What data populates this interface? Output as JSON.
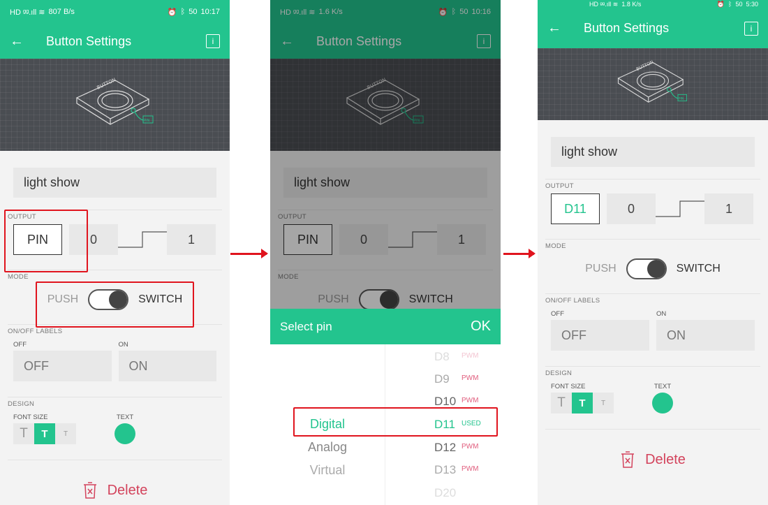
{
  "status_p1": {
    "speed": "807",
    "speed_unit": "B/s",
    "battery": "50",
    "time": "10:17"
  },
  "status_p2": {
    "speed": "1.6",
    "speed_unit": "K/s",
    "battery": "50",
    "time": "10:16"
  },
  "status_p3": {
    "speed": "1.8",
    "speed_unit": "K/s",
    "battery": "50",
    "time": "5:30"
  },
  "appbar": {
    "back": "←",
    "title": "Button Settings",
    "info": "i"
  },
  "hero": {
    "device_label": "BUTTON",
    "pin_tag": "PIN"
  },
  "form": {
    "name": "light show",
    "output_label": "OUTPUT",
    "pin": "PIN",
    "pin_selected": "D11",
    "low": "0",
    "high": "1",
    "mode_label": "MODE",
    "push": "PUSH",
    "switch": "SWITCH",
    "onoff_label": "ON/OFF LABELS",
    "off_small": "OFF",
    "on_small": "ON",
    "off_value": "OFF",
    "on_value": "ON",
    "design_label": "DESIGN",
    "font_size_label": "FONT SIZE",
    "font_sizes": [
      "T",
      "T",
      "T"
    ],
    "text_label": "TEXT",
    "delete": "Delete"
  },
  "picker": {
    "header": "Select pin",
    "ok": "OK",
    "types": [
      "Digital",
      "Analog",
      "Virtual"
    ],
    "pins": [
      {
        "name": "D8",
        "tag": "PWM"
      },
      {
        "name": "D9",
        "tag": "PWM"
      },
      {
        "name": "D10",
        "tag": "PWM"
      },
      {
        "name": "D11",
        "tag": "USED"
      },
      {
        "name": "D12",
        "tag": "PWM"
      },
      {
        "name": "D13",
        "tag": "PWM"
      },
      {
        "name": "D20",
        "tag": ""
      }
    ]
  },
  "colors": {
    "accent": "#23c48e",
    "highlight": "#e0141e",
    "delete": "#d3435c",
    "pwm": "#e05d7d"
  }
}
